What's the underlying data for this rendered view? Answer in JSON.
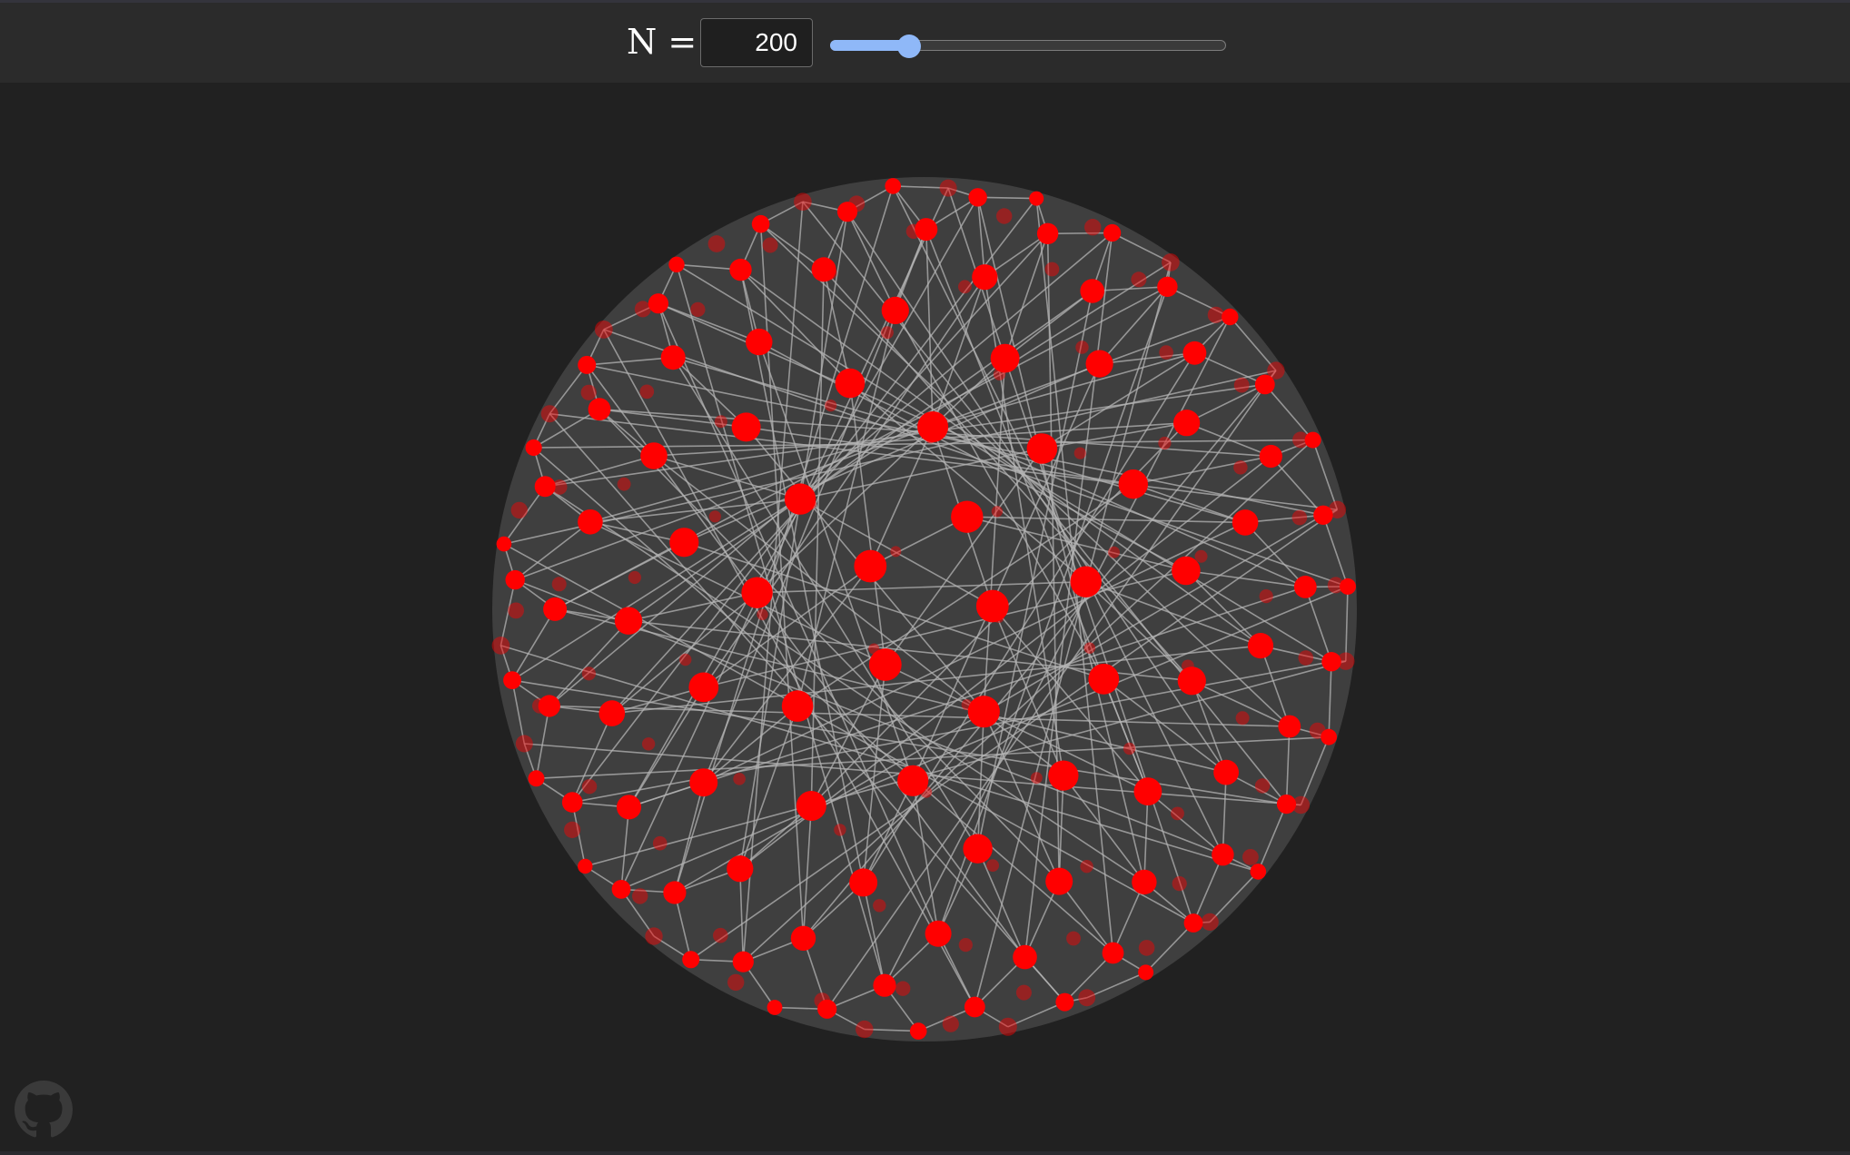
{
  "controls": {
    "n_label": "N =",
    "n_value": "200",
    "slider": {
      "value": 200,
      "min": 0,
      "max": 1000
    }
  },
  "sphere": {
    "point_count": 200,
    "point_color": "#ff0000",
    "edge_color": "#b4b4b4",
    "sphere_fill": "#3f3f3f",
    "background": "#212121"
  },
  "footer": {
    "github_icon": "github-icon"
  }
}
